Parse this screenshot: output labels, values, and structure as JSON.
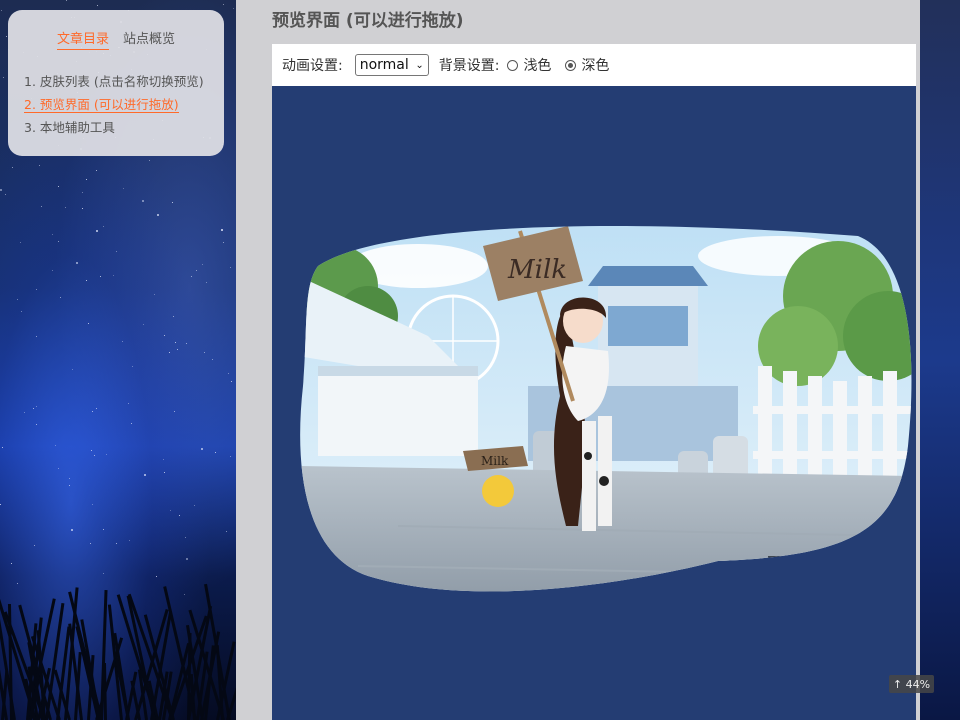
{
  "toc": {
    "tabs": [
      {
        "label": "文章目录",
        "active": true
      },
      {
        "label": "站点概览",
        "active": false
      }
    ],
    "items": [
      {
        "label": "1. 皮肤列表 (点击名称切换预览)",
        "active": false
      },
      {
        "label": "2. 预览界面 (可以进行拖放)",
        "active": true
      },
      {
        "label": "3. 本地辅助工具",
        "active": false
      }
    ]
  },
  "main": {
    "title": "预览界面 (可以进行拖放)",
    "toolbar": {
      "animation_label": "动画设置:",
      "animation_value": "normal",
      "background_label": "背景设置:",
      "bg_options": [
        {
          "label": "浅色",
          "checked": false
        },
        {
          "label": "深色",
          "checked": true
        }
      ]
    },
    "artwork": {
      "sign_text": "Milk",
      "small_sign_text": "Milk"
    }
  },
  "zoom": {
    "label": "↑ 44%"
  },
  "colors": {
    "accent": "#ff6a2a",
    "stage_bg": "#243d73",
    "page_bg": "#d0d0d3"
  }
}
